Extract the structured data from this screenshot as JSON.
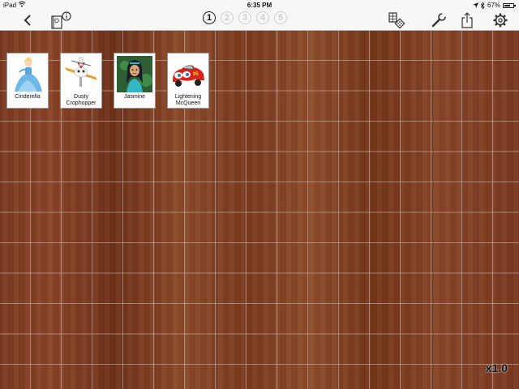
{
  "status_bar": {
    "carrier": "iPad",
    "time": "6:35 PM",
    "battery": "67%",
    "battery_level": 0.67
  },
  "toolbar": {
    "icons": {
      "back": "chevron-left-icon",
      "info_book": "book-info-icon",
      "grid": "grid-dice-icon",
      "settings_tool": "wrench-icon",
      "share": "share-icon",
      "gear": "gear-icon"
    },
    "pages": [
      "1",
      "2",
      "3",
      "4",
      "5"
    ],
    "active_page": "1"
  },
  "board": {
    "cards": [
      {
        "label": "Cinderella",
        "image": "cinderella-picture"
      },
      {
        "label": "Dusty Crophopper",
        "image": "dusty-plane-picture"
      },
      {
        "label": "Jasmine",
        "image": "jasmine-picture"
      },
      {
        "label": "Lightening McQueen",
        "image": "mcqueen-car-picture"
      }
    ],
    "zoom": "x1.0"
  },
  "colors": {
    "toolbar_bg": "#f7f7f7",
    "wood": "#7a3a1f",
    "grid_line": "#d2beb4",
    "inactive_page": "#cfcfcf"
  }
}
